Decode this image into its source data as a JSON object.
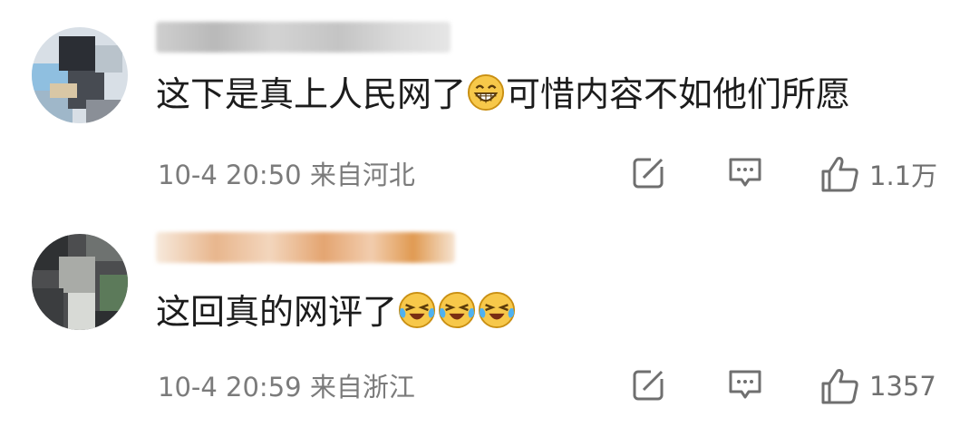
{
  "comments": [
    {
      "username": "用户名已打码",
      "text_before_emoji": "这下是真上人民网了",
      "emoji": [
        "grin-emoji"
      ],
      "text_after_emoji": "可惜内容不如他们所愿",
      "time": "10-4 20:50",
      "location": "来自河北",
      "likes": "1.1万"
    },
    {
      "username": "用户名已打码",
      "text_before_emoji": "这回真的网评了",
      "emoji": [
        "laugh-cry-emoji",
        "laugh-cry-emoji",
        "laugh-cry-emoji"
      ],
      "text_after_emoji": "",
      "time": "10-4 20:59",
      "location": "来自浙江",
      "likes": "1357"
    }
  ],
  "icons": {
    "forward": "share-icon",
    "reply": "comment-icon",
    "like": "thumbs-up-icon"
  },
  "colors": {
    "text": "#1c1c1c",
    "meta": "#7b7b7b",
    "icon": "#6f6f6f",
    "emoji": "#f7c84a"
  }
}
